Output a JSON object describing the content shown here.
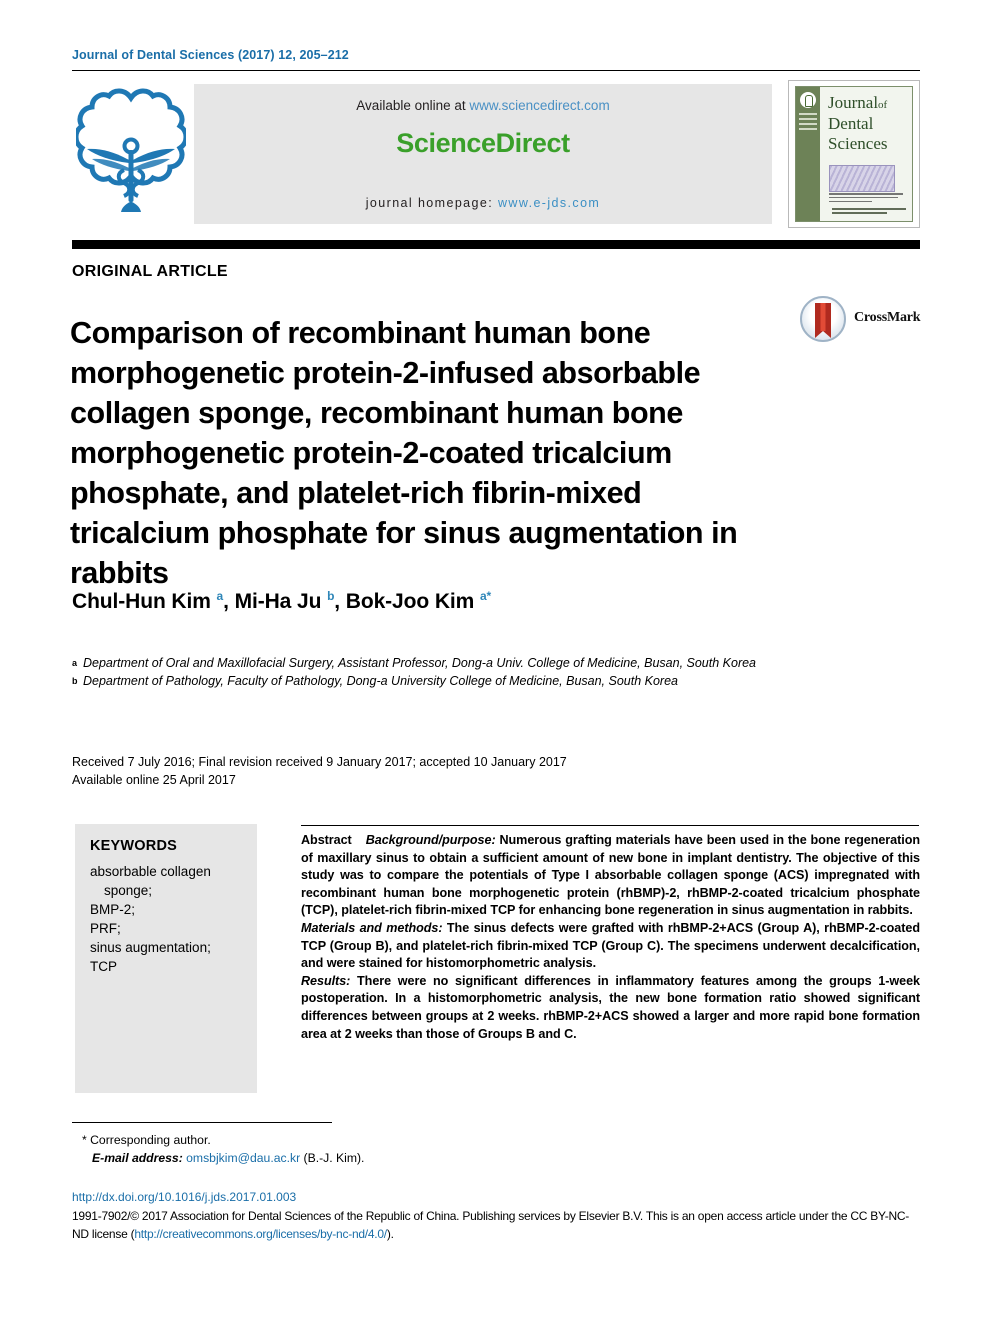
{
  "running_head": "Journal of Dental Sciences (2017) 12, 205–212",
  "masthead": {
    "available_online_prefix": "Available online at ",
    "sciencedirect_url": "www.sciencedirect.com",
    "sciencedirect_logo": "ScienceDirect",
    "journal_homepage_label": "journal homepage:",
    "journal_homepage_url": "www.e-jds.com",
    "cover": {
      "line1": "Journal",
      "of": "of",
      "line2": "Dental",
      "line3": "Sciences"
    },
    "society_logo_name": "dental-society-caduceus-emblem"
  },
  "article_type": "ORIGINAL ARTICLE",
  "title": "Comparison of recombinant human bone morphogenetic protein-2-infused absorbable collagen sponge, recombinant human bone morphogenetic protein-2-coated tricalcium phosphate, and platelet-rich fibrin-mixed tricalcium phosphate for sinus augmentation in rabbits",
  "crossmark_label": "CrossMark",
  "authors": [
    {
      "name": "Chul-Hun Kim",
      "marks": "a",
      "sep": ", "
    },
    {
      "name": "Mi-Ha Ju",
      "marks": "b",
      "sep": ", "
    },
    {
      "name": "Bok-Joo Kim",
      "marks": "a*",
      "sep": ""
    }
  ],
  "affiliations": [
    {
      "mark": "a",
      "text": "Department of Oral and Maxillofacial Surgery, Assistant Professor, Dong-a Univ. College of Medicine, Busan, South Korea"
    },
    {
      "mark": "b",
      "text": "Department of Pathology, Faculty of Pathology, Dong-a University College of Medicine, Busan, South Korea"
    }
  ],
  "dates": {
    "line1": "Received 7 July 2016; Final revision received 9 January 2017; accepted 10 January 2017",
    "line2": "Available online 25 April 2017"
  },
  "keywords": {
    "heading": "KEYWORDS",
    "items": [
      "absorbable collagen sponge;",
      "BMP-2;",
      "PRF;",
      "sinus augmentation;",
      "TCP"
    ]
  },
  "abstract": {
    "label": "Abstract",
    "sections": [
      {
        "heading": "Background/purpose:",
        "body": " Numerous grafting materials have been used in the bone regeneration of maxillary sinus to obtain a sufficient amount of new bone in implant dentistry. The objective of this study was to compare the potentials of Type I absorbable collagen sponge (ACS) impregnated with recombinant human bone morphogenetic protein (rhBMP)-2, rhBMP-2-coated tricalcium phosphate (TCP), platelet-rich fibrin-mixed TCP for enhancing bone regeneration in sinus augmentation in rabbits."
      },
      {
        "heading": "Materials and methods:",
        "body": " The sinus defects were grafted with rhBMP-2+ACS (Group A), rhBMP-2-coated TCP (Group B), and platelet-rich fibrin-mixed TCP (Group C). The specimens underwent decalcification, and were stained for histomorphometric analysis."
      },
      {
        "heading": "Results:",
        "body": " There were no significant differences in inflammatory features among the groups 1-week postoperation. In a histomorphometric analysis, the new bone formation ratio showed significant differences between groups at 2 weeks. rhBMP-2+ACS showed a larger and more rapid bone formation area at 2 weeks than those of Groups B and C."
      }
    ]
  },
  "footer": {
    "corresponding_author": "* Corresponding author.",
    "email_label": "E-mail address:",
    "email": "omsbjkim@dau.ac.kr",
    "email_suffix": " (B.-J. Kim).",
    "doi": "http://dx.doi.org/10.1016/j.jds.2017.01.003",
    "copyright_part1": "1991-7902/© 2017 Association for Dental Sciences of the Republic of China. Publishing services by Elsevier B.V. This is an open access article under the CC BY-NC-ND license (",
    "license_url": "http://creativecommons.org/licenses/by-nc-nd/4.0/",
    "copyright_part2": ")."
  },
  "colors": {
    "link_blue": "#1a6ea8",
    "sciencedirect_green": "#3aa02a",
    "banner_gray": "#e6e6e6",
    "society_blue": "#1f78b4",
    "cover_green": "#6d8257"
  }
}
